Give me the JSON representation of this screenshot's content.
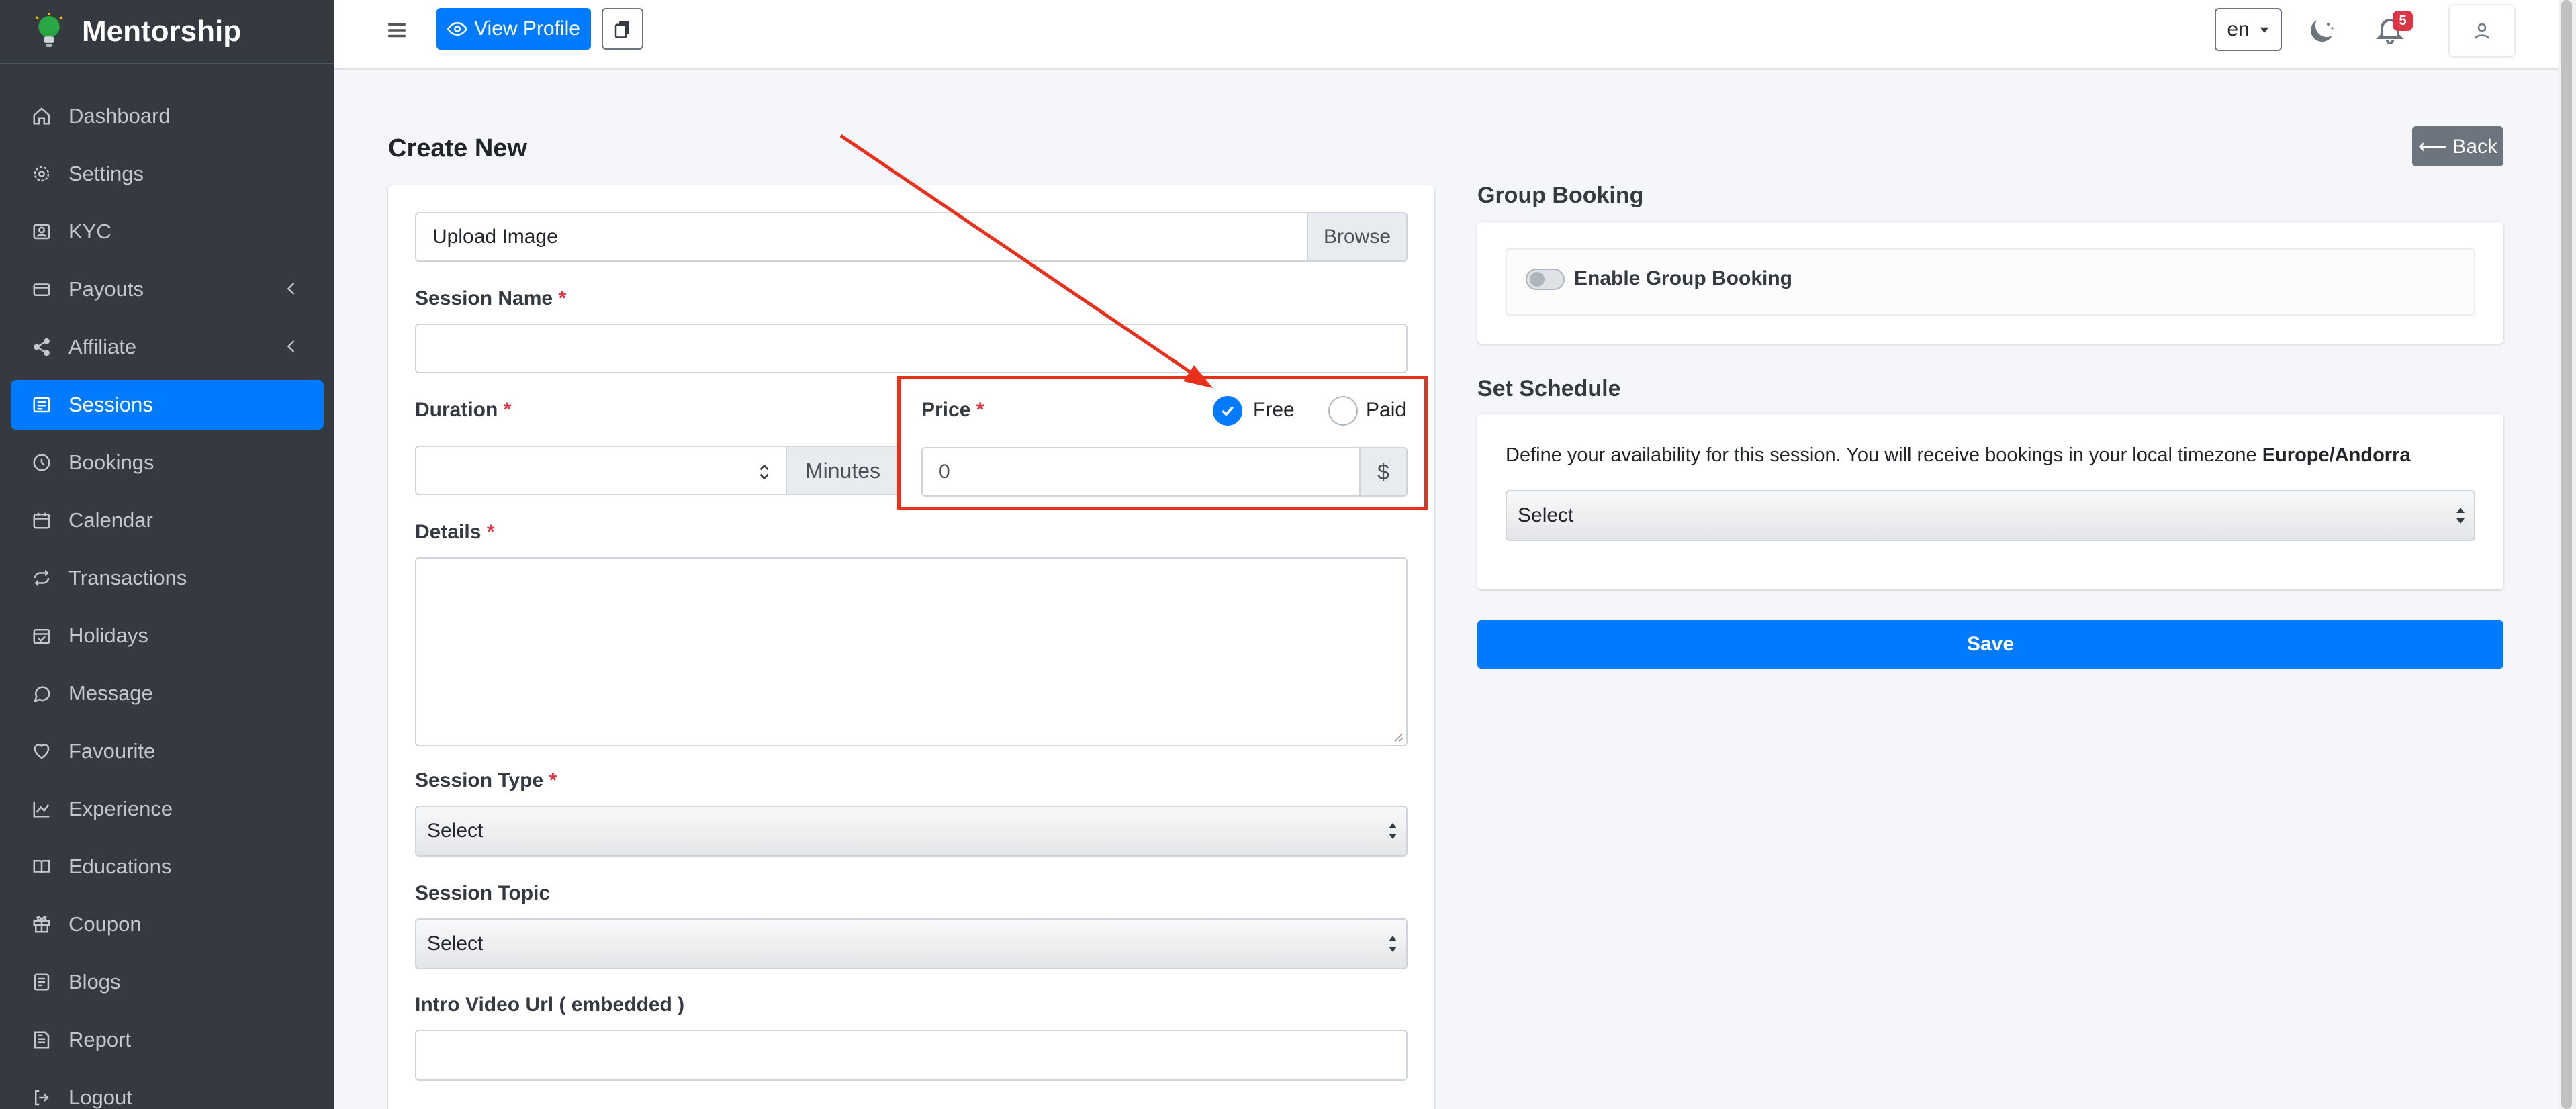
{
  "brand": {
    "name": "Mentorship"
  },
  "sidebar": {
    "items": [
      {
        "label": "Dashboard",
        "icon": "home-icon"
      },
      {
        "label": "Settings",
        "icon": "gear-icon"
      },
      {
        "label": "KYC",
        "icon": "id-badge-icon"
      },
      {
        "label": "Payouts",
        "icon": "wallet-icon"
      },
      {
        "label": "Affiliate",
        "icon": "share-icon"
      },
      {
        "label": "Sessions",
        "icon": "list-icon"
      },
      {
        "label": "Bookings",
        "icon": "clock-icon"
      },
      {
        "label": "Calendar",
        "icon": "calendar-icon"
      },
      {
        "label": "Transactions",
        "icon": "repeat-icon"
      },
      {
        "label": "Holidays",
        "icon": "calendar-check-icon"
      },
      {
        "label": "Message",
        "icon": "chat-icon"
      },
      {
        "label": "Favourite",
        "icon": "heart-icon"
      },
      {
        "label": "Experience",
        "icon": "chart-line-icon"
      },
      {
        "label": "Educations",
        "icon": "book-icon"
      },
      {
        "label": "Coupon",
        "icon": "gift-icon"
      },
      {
        "label": "Blogs",
        "icon": "blog-icon"
      },
      {
        "label": "Report",
        "icon": "report-icon"
      },
      {
        "label": "Logout",
        "icon": "logout-icon"
      }
    ],
    "active": "Sessions",
    "accent": "#007bff"
  },
  "topbar": {
    "view_profile_label": "View Profile",
    "language": "en",
    "notification_count": "5"
  },
  "page": {
    "title": "Create New",
    "back_label": "⟵ Back"
  },
  "form": {
    "upload_placeholder": "Upload Image",
    "browse_label": "Browse",
    "session_name_label": "Session Name",
    "session_name_value": "",
    "duration_label": "Duration",
    "duration_value": "",
    "duration_unit": "Minutes",
    "price_label": "Price",
    "price_options": [
      "Free",
      "Paid"
    ],
    "price_selected": "Free",
    "price_value": "0",
    "currency": "$",
    "details_label": "Details",
    "session_type_label": "Session Type",
    "session_type_value": "Select",
    "session_topic_label": "Session Topic",
    "session_topic_value": "Select",
    "intro_video_label": "Intro Video Url ( embedded )",
    "intro_video_value": "",
    "required_mark": "*"
  },
  "group_booking": {
    "title": "Group Booking",
    "toggle_label": "Enable Group Booking",
    "enabled": false
  },
  "schedule": {
    "title": "Set Schedule",
    "description": "Define your availability for this session. You will receive bookings in your local timezone",
    "timezone": "Europe/Andorra",
    "select_value": "Select"
  },
  "save_label": "Save",
  "annotation_color": "#e8301c"
}
